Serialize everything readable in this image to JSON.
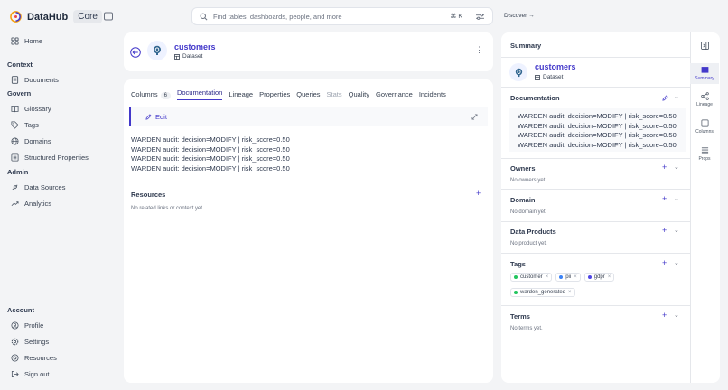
{
  "app": {
    "name": "DataHub",
    "badge": "Core"
  },
  "nav": {
    "home": "Home",
    "context_title": "Context",
    "documents": "Documents",
    "govern_title": "Govern",
    "glossary": "Glossary",
    "tags": "Tags",
    "domains": "Domains",
    "structured_properties": "Structured Properties",
    "admin_title": "Admin",
    "data_sources": "Data Sources",
    "analytics": "Analytics",
    "account_title": "Account",
    "profile": "Profile",
    "settings": "Settings",
    "resources": "Resources",
    "sign_out": "Sign out"
  },
  "search": {
    "placeholder": "Find tables, dashboards, people, and more",
    "shortcut": "⌘ K"
  },
  "discover": {
    "label": "Discover →"
  },
  "entity": {
    "name": "customers",
    "type": "Dataset"
  },
  "tabs": {
    "columns": "Columns",
    "columns_count": "6",
    "documentation": "Documentation",
    "lineage": "Lineage",
    "properties": "Properties",
    "queries": "Queries",
    "stats": "Stats",
    "quality": "Quality",
    "governance": "Governance",
    "incidents": "Incidents"
  },
  "doc": {
    "edit_label": "Edit",
    "lines": [
      "WARDEN audit: decision=MODIFY | risk_score=0.50",
      "WARDEN audit: decision=MODIFY | risk_score=0.50",
      "WARDEN audit: decision=MODIFY | risk_score=0.50",
      "WARDEN audit: decision=MODIFY | risk_score=0.50"
    ]
  },
  "resources": {
    "title": "Resources",
    "empty": "No related links or context yet"
  },
  "summary": {
    "title": "Summary",
    "documentation_title": "Documentation",
    "owners_title": "Owners",
    "owners_empty": "No owners yet.",
    "domain_title": "Domain",
    "domain_empty": "No domain yet.",
    "data_products_title": "Data Products",
    "data_products_empty": "No product yet.",
    "tags_title": "Tags",
    "tags": [
      {
        "label": "customer",
        "color": "#22c55e"
      },
      {
        "label": "pii",
        "color": "#3b82f6"
      },
      {
        "label": "gdpr",
        "color": "#4f46e5"
      },
      {
        "label": "warden_generated",
        "color": "#22c55e"
      }
    ],
    "terms_title": "Terms",
    "terms_empty": "No terms yet."
  },
  "rail": {
    "summary": "Summary",
    "lineage": "Lineage",
    "columns": "Columns",
    "props": "Props"
  },
  "colors": {
    "accent": "#4338ca",
    "background": "#f3f4f6"
  }
}
